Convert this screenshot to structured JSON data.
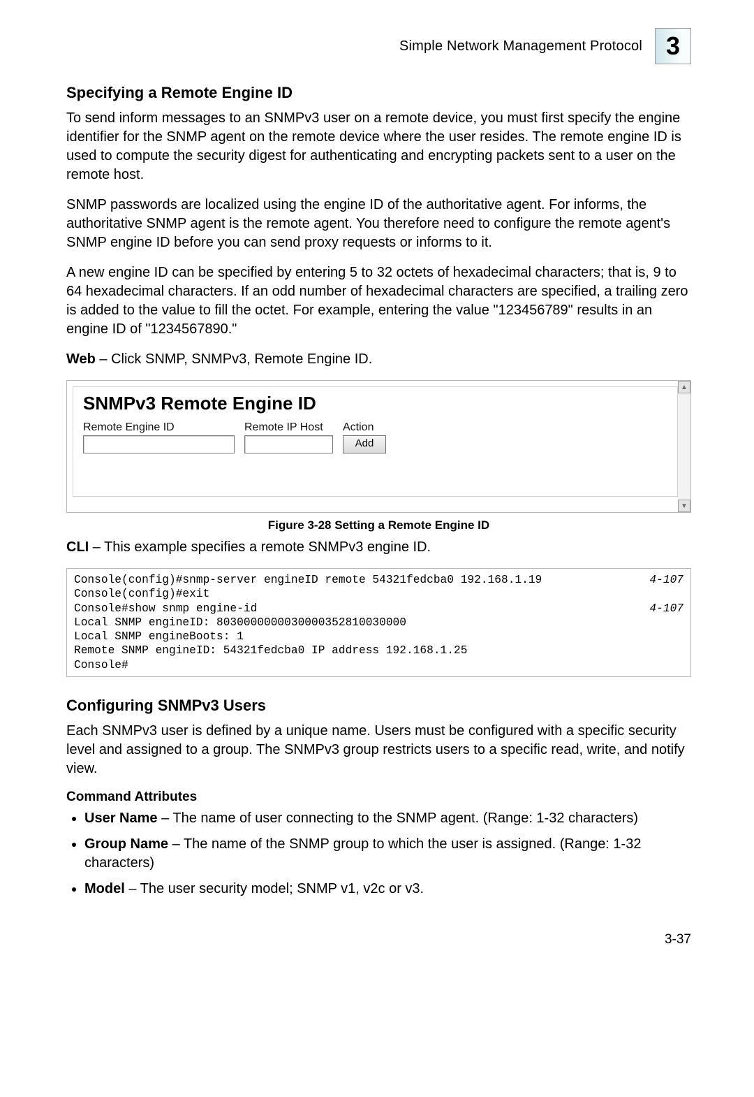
{
  "header": {
    "title": "Simple Network Management Protocol",
    "chapter_number": "3"
  },
  "section1": {
    "heading": "Specifying a Remote Engine ID",
    "p1": "To send inform messages to an SNMPv3 user on a remote device, you must first specify the engine identifier for the SNMP agent on the remote device where the user resides. The remote engine ID is used to compute the security digest for authenticating and encrypting packets sent to a user on the remote host.",
    "p2": "SNMP passwords are localized using the engine ID of the authoritative agent. For informs, the authoritative SNMP agent is the remote agent. You therefore need to configure the remote agent's SNMP engine ID before you can send proxy requests or informs to it.",
    "p3": "A new engine ID can be specified by entering 5 to 32 octets of hexadecimal characters; that is, 9 to 64 hexadecimal characters. If an odd number of hexadecimal characters are specified, a trailing zero is added to the value to fill the octet. For example, entering the value \"123456789\" results in an engine ID of \"1234567890.\"",
    "web_label": "Web",
    "web_text": " – Click SNMP, SNMPv3, Remote Engine ID."
  },
  "screenshot": {
    "panel_title": "SNMPv3 Remote Engine ID",
    "col_engine": "Remote Engine ID",
    "col_ip": "Remote IP Host",
    "col_action": "Action",
    "add_button": "Add"
  },
  "figure_caption": "Figure 3-28  Setting a Remote Engine ID",
  "cli_intro_label": "CLI",
  "cli_intro_text": " – This example specifies a remote SNMPv3 engine ID.",
  "cli": {
    "line1_cmd": "Console(config)#snmp-server engineID remote 54321fedcba0 192.168.1.19",
    "line1_ref": "4-107",
    "line2": "Console(config)#exit",
    "line3_cmd": "Console#show snmp engine-id",
    "line3_ref": "4-107",
    "line4": "Local SNMP engineID: 8030000000030000352810030000",
    "line5": "Local SNMP engineBoots: 1",
    "line6": "Remote SNMP engineID: 54321fedcba0 IP address 192.168.1.25",
    "line7": "Console#"
  },
  "section2": {
    "heading": "Configuring SNMPv3 Users",
    "p1": "Each SNMPv3 user is defined by a unique name. Users must be configured with a specific security level and assigned to a group. The SNMPv3 group restricts users to a specific read, write, and notify view.",
    "cmd_attr_heading": "Command Attributes",
    "bullets": {
      "user_name_label": "User Name",
      "user_name_text": " – The name of user connecting to the SNMP agent. (Range: 1-32 characters)",
      "group_name_label": "Group Name",
      "group_name_text": " – The name of the SNMP group to which the user is assigned. (Range: 1-32 characters)",
      "model_label": "Model",
      "model_text": " – The user security model; SNMP v1, v2c or v3."
    }
  },
  "page_number": "3-37"
}
